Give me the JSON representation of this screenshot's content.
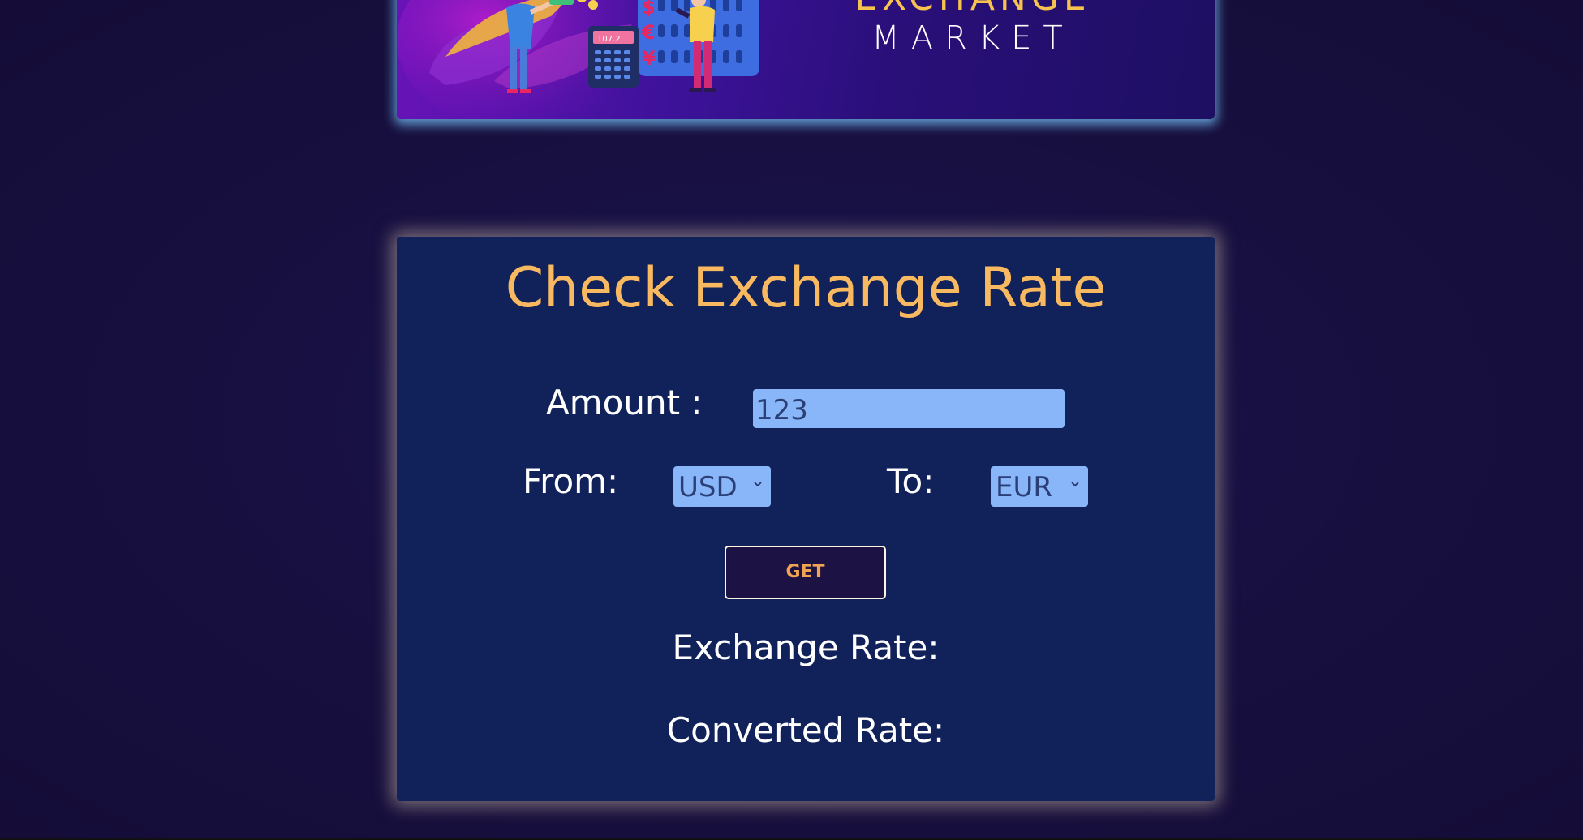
{
  "banner": {
    "title": "EXCHANGE",
    "subtitle": "MARKET",
    "calculator_display": "107.2",
    "currency_symbols": [
      "$",
      "€",
      "¥"
    ]
  },
  "converter": {
    "title": "Check Exchange Rate",
    "amount_label": "Amount :",
    "amount_value": "123",
    "from_label": "From:",
    "from_value": "USD",
    "to_label": "To:",
    "to_value": "EUR",
    "get_button": "GET",
    "exchange_rate_label": "Exchange Rate:",
    "converted_rate_label": "Converted Rate:"
  },
  "colors": {
    "page_background": "#170f3e",
    "card_background": "#11215a",
    "title_color": "#f8b960",
    "input_background": "#89b6f8",
    "button_background": "#1d1244",
    "button_text": "#f0a451"
  }
}
